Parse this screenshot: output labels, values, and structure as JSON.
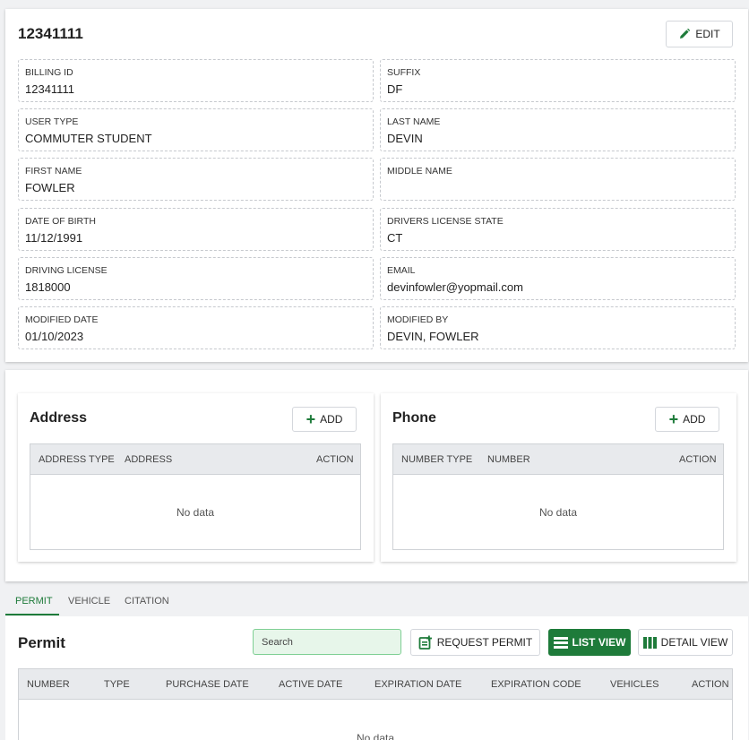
{
  "profile": {
    "title": "12341111",
    "edit_label": "EDIT",
    "fields": [
      {
        "label": "BILLING ID",
        "value": "12341111"
      },
      {
        "label": "SUFFIX",
        "value": "DF"
      },
      {
        "label": "USER TYPE",
        "value": "COMMUTER STUDENT"
      },
      {
        "label": "LAST NAME",
        "value": "DEVIN"
      },
      {
        "label": "FIRST NAME",
        "value": "FOWLER"
      },
      {
        "label": "MIDDLE NAME",
        "value": ""
      },
      {
        "label": "DATE OF BIRTH",
        "value": "11/12/1991"
      },
      {
        "label": "DRIVERS LICENSE STATE",
        "value": "CT"
      },
      {
        "label": "DRIVING LICENSE",
        "value": "1818000"
      },
      {
        "label": "EMAIL",
        "value": "devinfowler@yopmail.com"
      },
      {
        "label": "MODIFIED DATE",
        "value": "01/10/2023"
      },
      {
        "label": "MODIFIED BY",
        "value": "DEVIN, FOWLER"
      }
    ]
  },
  "address": {
    "title": "Address",
    "add_label": "ADD",
    "columns": [
      "ADDRESS TYPE",
      "ADDRESS",
      "ACTION"
    ],
    "empty_text": "No data"
  },
  "phone": {
    "title": "Phone",
    "add_label": "ADD",
    "columns": [
      "NUMBER TYPE",
      "NUMBER",
      "ACTION"
    ],
    "empty_text": "No data"
  },
  "tabs": [
    {
      "label": "PERMIT",
      "active": true
    },
    {
      "label": "VEHICLE",
      "active": false
    },
    {
      "label": "CITATION",
      "active": false
    }
  ],
  "permit": {
    "title": "Permit",
    "search_placeholder": "Search",
    "request_label": "REQUEST PERMIT",
    "list_view_label": "LIST VIEW",
    "detail_view_label": "DETAIL VIEW",
    "columns": [
      "NUMBER",
      "TYPE",
      "PURCHASE DATE",
      "ACTIVE DATE",
      "EXPIRATION DATE",
      "EXPIRATION CODE",
      "VEHICLES",
      "ACTION"
    ],
    "empty_text": "No data"
  },
  "icons": {
    "edit": "pencil-icon",
    "add": "plus-icon",
    "request": "add-document-icon",
    "list_view": "list-icon",
    "detail_view": "columns-icon"
  },
  "colors": {
    "accent": "#1e7b3a",
    "search_bg": "#e7f6ea"
  }
}
